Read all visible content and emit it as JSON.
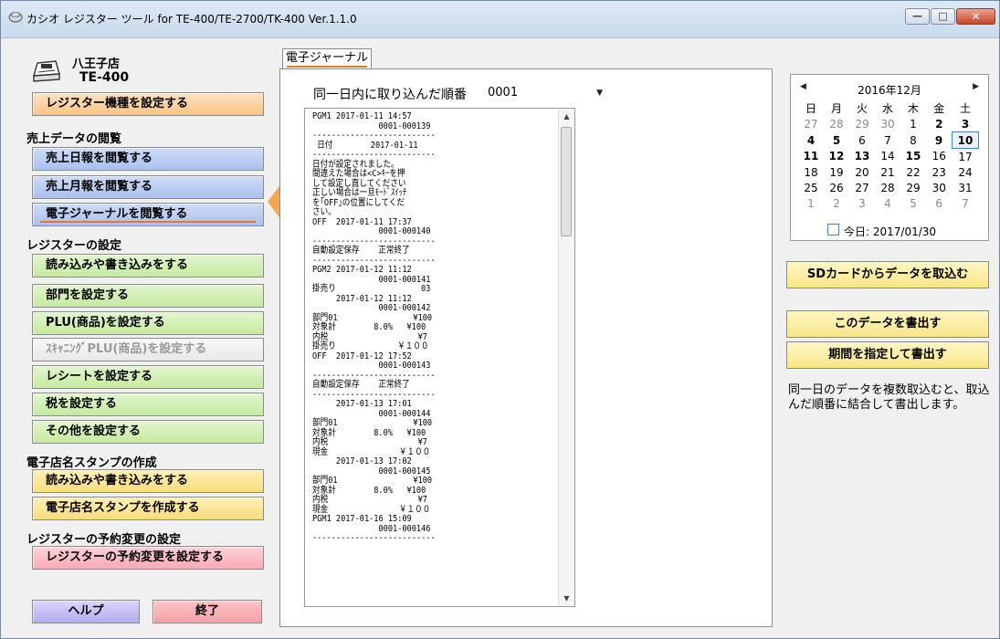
{
  "window": {
    "title": "カシオ レジスター ツール for TE-400/TE-2700/TK-400 Ver.1.1.0",
    "min_glyph": "—",
    "max_glyph": "□",
    "close_glyph": "✕"
  },
  "left": {
    "store_name": "八王子店",
    "model_name": "TE-400",
    "set_model_button": "レジスター機種を設定する",
    "sales_section": "売上データの閲覧",
    "daily_report": "売上日報を閲覧する",
    "monthly_report": "売上月報を閲覧する",
    "e_journal": "電子ジャーナルを閲覧する",
    "register_section": "レジスターの設定",
    "read_write": "読み込みや書き込みをする",
    "dept": "部門を設定する",
    "plu": "PLU(商品)を設定する",
    "scan_plu": "ｽｷｬﾆﾝｸﾞPLU(商品)を設定する",
    "receipt": "レシートを設定する",
    "tax": "税を設定する",
    "other": "その他を設定する",
    "stamp_section": "電子店名スタンプの作成",
    "stamp_read_write": "読み込みや書き込みをする",
    "stamp_create": "電子店名スタンプを作成する",
    "reserve_section": "レジスターの予約変更の設定",
    "reserve_button": "レジスターの予約変更を設定する",
    "help": "ヘルプ",
    "exit": "終了"
  },
  "center": {
    "tab_label": "電子ジャーナル",
    "order_label": "同一日内に取り込んだ順番",
    "order_value": "0001",
    "journal_lines": [
      "PGM1 2017-01-11 14:57",
      "              0001-000139",
      "--------------------------",
      " 日付        2017-01-11",
      "--------------------------",
      "日付が設定されました。",
      "間違えた場合は<C>ｷｰを押",
      "して設定し直してください",
      "正しい場合は一旦ﾓｰﾄﾞｽｲｯﾁ",
      "を｢OFF｣の位置にしてくだ",
      "さい。",
      "OFF  2017-01-11 17:37",
      "              0001-000140",
      "--------------------------",
      "自動設定保存    正常終了",
      "--------------------------",
      "PGM2 2017-01-12 11:12",
      "              0001-000141",
      "掛売り                  03",
      "     2017-01-12 11:12",
      "              0001-000142",
      "部門01                ¥100",
      "対象計        8.0%   ¥100",
      "内税                   ¥7",
      "掛売り             ￥１００",
      "OFF  2017-01-12 17:52",
      "              0001-000143",
      "--------------------------",
      "自動設定保存    正常終了",
      "--------------------------",
      "     2017-01-13 17:01",
      "              0001-000144",
      "部門01                ¥100",
      "対象計        8.0%   ¥100",
      "内税                   ¥7",
      "現金               ￥１００",
      "     2017-01-13 17:02",
      "              0001-000145",
      "部門01                ¥100",
      "対象計        8.0%   ¥100",
      "内税                   ¥7",
      "現金               ￥１００",
      "PGM1 2017-01-16 15:09",
      "              0001-000146",
      "--------------------------"
    ]
  },
  "right": {
    "calendar_month": "2016年12月",
    "weekdays": [
      "日",
      "月",
      "火",
      "水",
      "木",
      "金",
      "土"
    ],
    "weeks": [
      [
        "27",
        "28",
        "29",
        "30",
        "1",
        "2",
        "3"
      ],
      [
        "4",
        "5",
        "6",
        "7",
        "8",
        "9",
        "10"
      ],
      [
        "11",
        "12",
        "13",
        "14",
        "15",
        "16",
        "17"
      ],
      [
        "18",
        "19",
        "20",
        "21",
        "22",
        "23",
        "24"
      ],
      [
        "25",
        "26",
        "27",
        "28",
        "29",
        "30",
        "31"
      ],
      [
        "1",
        "2",
        "3",
        "4",
        "5",
        "6",
        "7"
      ]
    ],
    "bold_days": [
      "2",
      "3",
      "4",
      "5",
      "9",
      "10",
      "11",
      "12",
      "13",
      "15"
    ],
    "selected_day": "10",
    "today_label": "今日: 2017/01/30",
    "sd_import": "SDカードからデータを取込む",
    "export_this": "このデータを書出す",
    "export_range": "期間を指定して書出す",
    "note": "同一日のデータを複数取込むと、取込んだ順番に結合して書出します。"
  }
}
